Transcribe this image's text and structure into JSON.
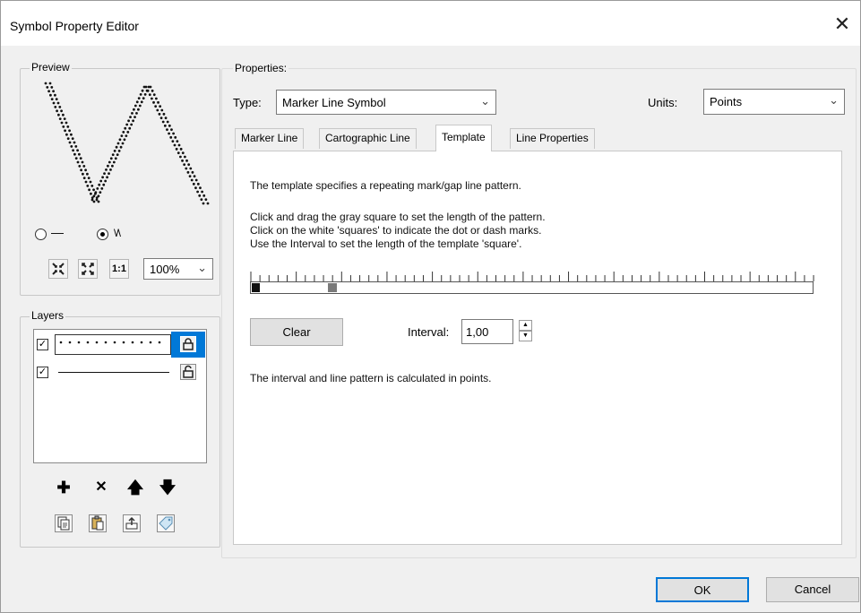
{
  "window": {
    "title": "Symbol Property Editor",
    "close_glyph": "✕"
  },
  "preview": {
    "label": "Preview",
    "radio_line_glyph": "—",
    "radio_wave_glyph": "\\/\\",
    "zoom": "100%",
    "selected_mode": "wave"
  },
  "layers": {
    "label": "Layers",
    "items": [
      {
        "checked": true,
        "selected": true,
        "style": "dotted"
      },
      {
        "checked": true,
        "selected": false,
        "style": "solid"
      }
    ]
  },
  "properties": {
    "label": "Properties:",
    "type_label": "Type:",
    "type_value": "Marker Line Symbol",
    "units_label": "Units:",
    "units_value": "Points"
  },
  "tabs": [
    "Marker Line",
    "Cartographic Line",
    "Template",
    "Line Properties"
  ],
  "active_tab": "Template",
  "template": {
    "desc": "The template specifies a repeating mark/gap line pattern.",
    "instr1": "Click and drag the gray square to set the length of the pattern.",
    "instr2": "Click on the white 'squares' to indicate the dot or dash marks.",
    "instr3": "Use the Interval to set the length of the template 'square'.",
    "clear_label": "Clear",
    "interval_label": "Interval:",
    "interval_value": "1,00",
    "footer": "The interval and line pattern is calculated in points."
  },
  "buttons": {
    "ok": "OK",
    "cancel": "Cancel"
  },
  "colors": {
    "accent": "#0078d7",
    "selected_layer": "#cce4f7"
  }
}
